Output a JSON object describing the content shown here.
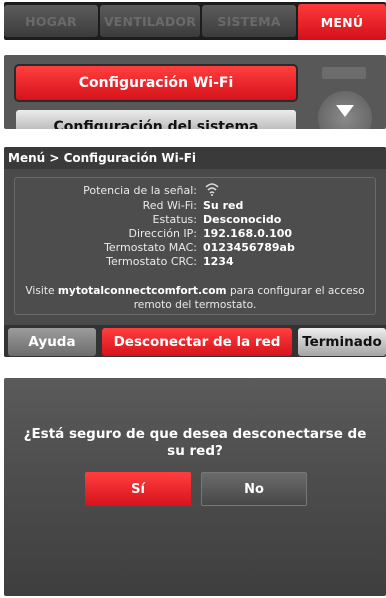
{
  "tabs": [
    {
      "label": "HOGAR"
    },
    {
      "label": "VENTILADOR"
    },
    {
      "label": "SISTEMA"
    },
    {
      "label": "MENÚ"
    }
  ],
  "menu": {
    "items": [
      {
        "label": "Configuración Wi-Fi"
      },
      {
        "label": "Configuración del sistema"
      }
    ]
  },
  "wifi": {
    "breadcrumb": "Menú > Configuración Wi-Fi",
    "rows": [
      {
        "key": "Potencia de la señal:",
        "value": ""
      },
      {
        "key": "Red Wi-Fi:",
        "value": "Su red"
      },
      {
        "key": "Estatus:",
        "value": "Desconocido"
      },
      {
        "key": "Dirección IP:",
        "value": "192.168.0.100"
      },
      {
        "key": "Termostato MAC:",
        "value": "0123456789ab"
      },
      {
        "key": "Termostato CRC:",
        "value": "1234"
      }
    ],
    "visit_prefix": "Visite ",
    "visit_site": "mytotalconnectcomfort.com",
    "visit_suffix": " para configurar el acceso remoto del termostato.",
    "help_label": "Ayuda",
    "disconnect_label": "Desconectar de la red",
    "done_label": "Terminado"
  },
  "confirm": {
    "question": "¿Está seguro de que desea desconectarse de su red?",
    "yes_label": "Sí",
    "no_label": "No"
  },
  "icons": {
    "signal": "wifi-signal-icon",
    "scroll": "chevron-down-icon"
  },
  "colors": {
    "accent_red": "#e01b22",
    "panel_grey": "#4a4a4a"
  }
}
